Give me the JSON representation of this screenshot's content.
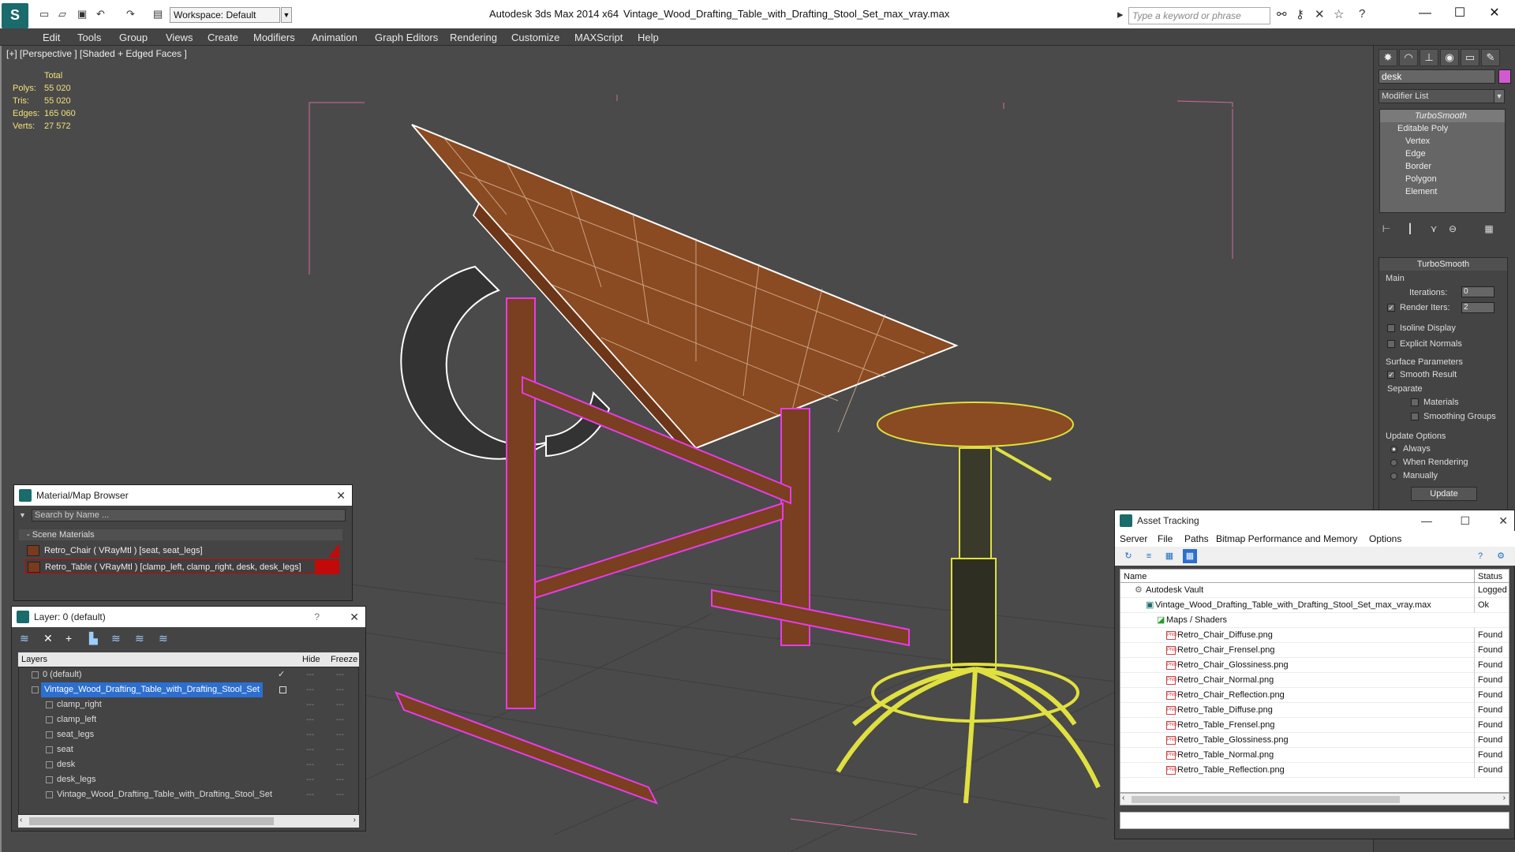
{
  "titlebar": {
    "workspace_label": "Workspace: Default",
    "app_title": "Autodesk 3ds Max  2014 x64",
    "file_title": "Vintage_Wood_Drafting_Table_with_Drafting_Stool_Set_max_vray.max",
    "search_placeholder": "Type a keyword or phrase"
  },
  "menu": [
    "Edit",
    "Tools",
    "Group",
    "Views",
    "Create",
    "Modifiers",
    "Animation",
    "Graph Editors",
    "Rendering",
    "Customize",
    "MAXScript",
    "Help"
  ],
  "viewport": {
    "label": "[+] [Perspective ] [Shaded + Edged Faces ]",
    "stats": {
      "total_label": "Total",
      "polys_label": "Polys:",
      "polys": "55 020",
      "tris_label": "Tris:",
      "tris": "55 020",
      "edges_label": "Edges:",
      "edges": "165 060",
      "verts_label": "Verts:",
      "verts": "27 572"
    }
  },
  "command_panel": {
    "object_name": "desk",
    "object_color": "#d25ad0",
    "modifier_list": "Modifier List",
    "stack": [
      "TurboSmooth",
      "Editable Poly",
      "Vertex",
      "Edge",
      "Border",
      "Polygon",
      "Element"
    ],
    "turbosmooth": {
      "title": "TurboSmooth",
      "main_label": "Main",
      "iterations_label": "Iterations:",
      "iterations": "0",
      "render_iters_label": "Render Iters:",
      "render_iters": "2",
      "isoline": "Isoline Display",
      "explicit_normals": "Explicit Normals",
      "surface_label": "Surface Parameters",
      "smooth_result": "Smooth Result",
      "separate_label": "Separate",
      "materials": "Materials",
      "smoothing_groups": "Smoothing Groups",
      "update_options_label": "Update Options",
      "always": "Always",
      "when_rendering": "When Rendering",
      "manually": "Manually",
      "update_btn": "Update"
    }
  },
  "material_browser": {
    "title": "Material/Map Browser",
    "search_placeholder": "Search by Name ...",
    "group": "- Scene Materials",
    "items": [
      "Retro_Chair  ( VRayMtl )  [seat, seat_legs]",
      "Retro_Table  ( VRayMtl )  [clamp_left, clamp_right, desk, desk_legs]"
    ]
  },
  "layer_panel": {
    "title": "Layer: 0 (default)",
    "help": "?",
    "col_layers": "Layers",
    "col_hide": "Hide",
    "col_freeze": "Freeze",
    "rows": [
      {
        "name": "0 (default)",
        "indent": 0
      },
      {
        "name": "Vintage_Wood_Drafting_Table_with_Drafting_Stool_Set",
        "indent": 0,
        "selected": true
      },
      {
        "name": "clamp_right",
        "indent": 1
      },
      {
        "name": "clamp_left",
        "indent": 1
      },
      {
        "name": "seat_legs",
        "indent": 1
      },
      {
        "name": "seat",
        "indent": 1
      },
      {
        "name": "desk",
        "indent": 1
      },
      {
        "name": "desk_legs",
        "indent": 1
      },
      {
        "name": "Vintage_Wood_Drafting_Table_with_Drafting_Stool_Set",
        "indent": 1
      }
    ]
  },
  "asset_tracking": {
    "title": "Asset Tracking",
    "menu": [
      "Server",
      "File",
      "Paths",
      "Bitmap Performance and Memory",
      "Options"
    ],
    "col_name": "Name",
    "col_status": "Status",
    "rows": [
      {
        "name": "Autodesk Vault",
        "status": "Logged Out",
        "level": 0
      },
      {
        "name": "Vintage_Wood_Drafting_Table_with_Drafting_Stool_Set_max_vray.max",
        "status": "Ok",
        "level": 1
      },
      {
        "name": "Maps / Shaders",
        "status": "",
        "level": 2
      },
      {
        "name": "Retro_Chair_Diffuse.png",
        "status": "Found",
        "level": 3
      },
      {
        "name": "Retro_Chair_Frensel.png",
        "status": "Found",
        "level": 3
      },
      {
        "name": "Retro_Chair_Glossiness.png",
        "status": "Found",
        "level": 3
      },
      {
        "name": "Retro_Chair_Normal.png",
        "status": "Found",
        "level": 3
      },
      {
        "name": "Retro_Chair_Reflection.png",
        "status": "Found",
        "level": 3
      },
      {
        "name": "Retro_Table_Diffuse.png",
        "status": "Found",
        "level": 3
      },
      {
        "name": "Retro_Table_Frensel.png",
        "status": "Found",
        "level": 3
      },
      {
        "name": "Retro_Table_Glossiness.png",
        "status": "Found",
        "level": 3
      },
      {
        "name": "Retro_Table_Normal.png",
        "status": "Found",
        "level": 3
      },
      {
        "name": "Retro_Table_Reflection.png",
        "status": "Found",
        "level": 3
      }
    ]
  }
}
